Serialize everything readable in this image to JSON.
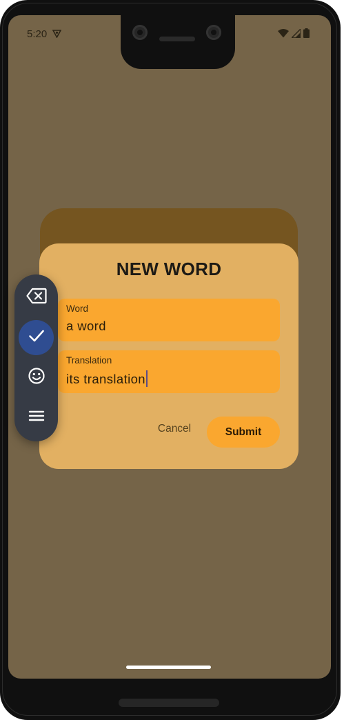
{
  "status_bar": {
    "time": "5:20",
    "vpn_icon": "vpn-key-icon",
    "wifi_icon": "wifi-icon",
    "signal_icon": "cell-signal-icon",
    "battery_icon": "battery-icon"
  },
  "dialog": {
    "title": "NEW WORD",
    "word_field": {
      "label": "Word",
      "value": "a word"
    },
    "translation_field": {
      "label": "Translation",
      "value": "its translation"
    },
    "cancel_label": "Cancel",
    "submit_label": "Submit"
  },
  "floating_toolbar": {
    "items": [
      {
        "icon": "backspace-icon"
      },
      {
        "icon": "check-icon",
        "selected": true
      },
      {
        "icon": "emoji-icon"
      },
      {
        "icon": "menu-icon"
      }
    ]
  },
  "colors": {
    "scrim": "#756448",
    "dialog_bg": "#e2b062",
    "accent": "#faa72f",
    "toolbar_bg": "#363b45",
    "toolbar_selected": "#2f4d91"
  }
}
